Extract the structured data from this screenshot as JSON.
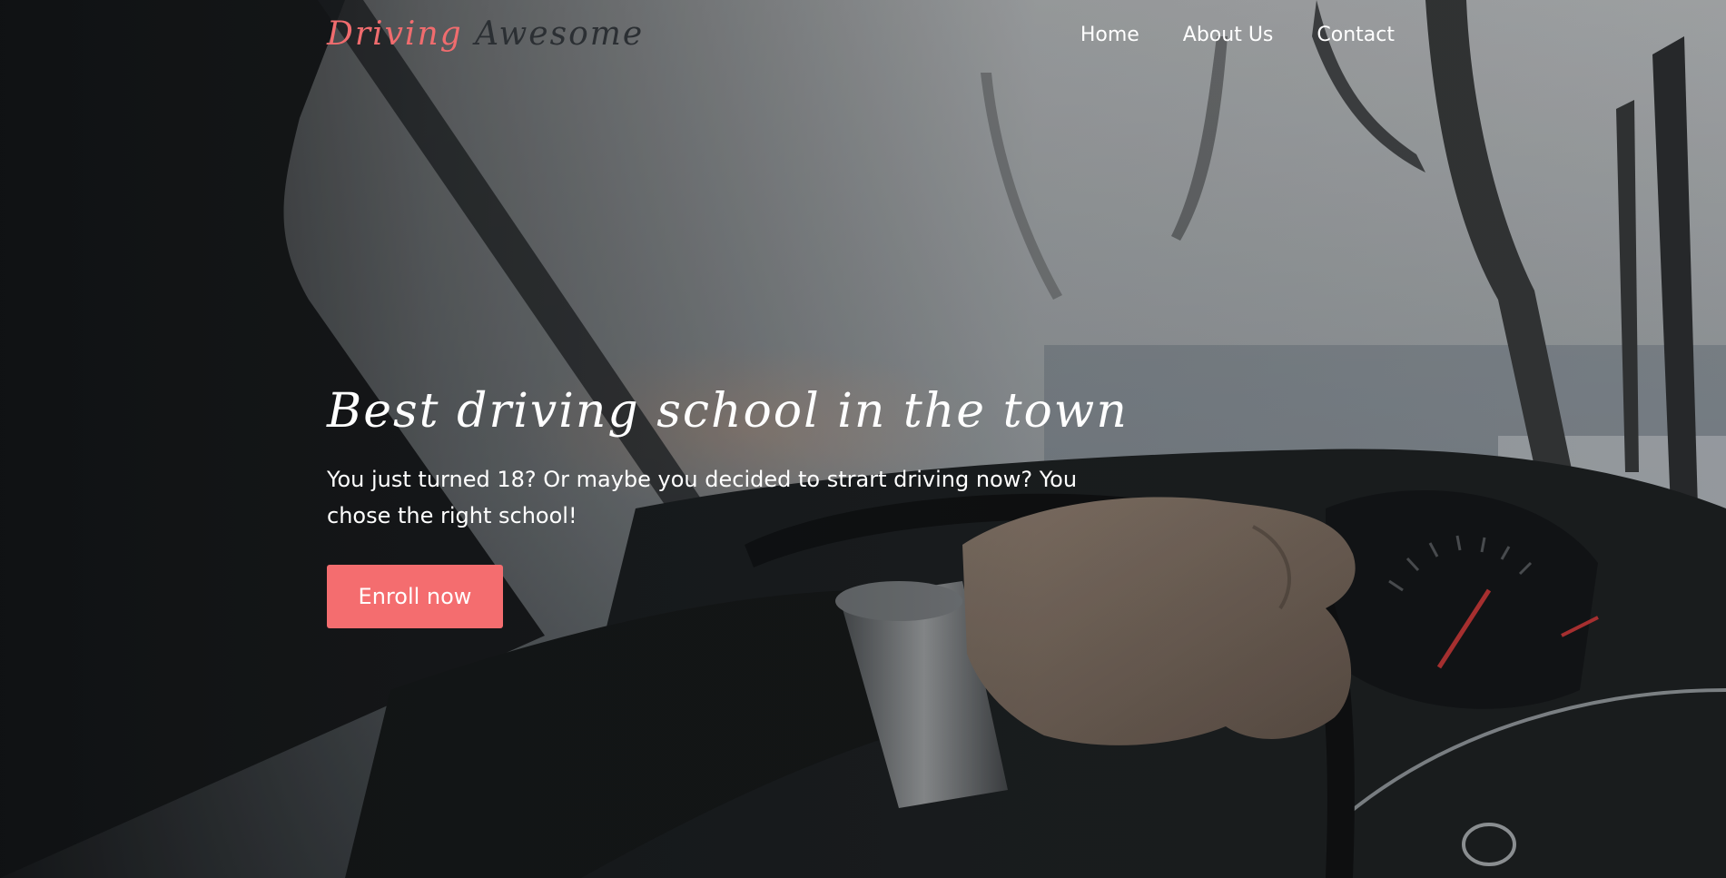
{
  "brand": {
    "first": "Driving",
    "second": " Awesome"
  },
  "nav": {
    "items": [
      {
        "label": "Home"
      },
      {
        "label": "About Us"
      },
      {
        "label": "Contact"
      }
    ]
  },
  "hero": {
    "title": "Best driving school in the town",
    "subtitle": "You just turned 18? Or maybe you decided to strart driving now? You chose the right school!",
    "cta_label": "Enroll now",
    "background_icon": "car-interior-photo"
  },
  "colors": {
    "accent": "#f46d6f",
    "brand_dark": "#2b2f33",
    "text_light": "#ffffff"
  }
}
